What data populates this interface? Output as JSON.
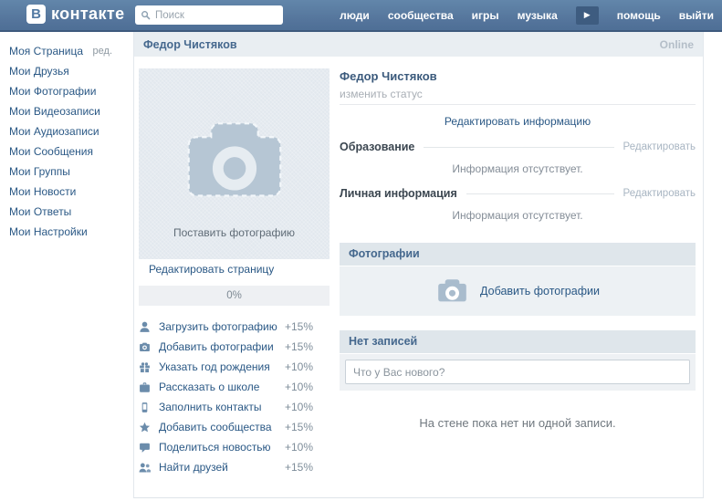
{
  "topbar": {
    "logo_letter": "В",
    "logo_word": "контакте",
    "search": {
      "placeholder": "Поиск"
    },
    "nav_items": [
      "люди",
      "сообщества",
      "игры",
      "музыка"
    ],
    "nav_items_after": [
      "помощь",
      "выйти"
    ]
  },
  "sidebar": {
    "items": [
      {
        "label": "Моя Страница",
        "edit": "ред."
      },
      {
        "label": "Мои Друзья"
      },
      {
        "label": "Мои Фотографии"
      },
      {
        "label": "Мои Видеозаписи"
      },
      {
        "label": "Мои Аудиозаписи"
      },
      {
        "label": "Мои Сообщения"
      },
      {
        "label": "Мои Группы"
      },
      {
        "label": "Мои Новости"
      },
      {
        "label": "Мои Ответы"
      },
      {
        "label": "Мои Настройки"
      }
    ]
  },
  "header": {
    "title": "Федор Чистяков",
    "status": "Online"
  },
  "profile_left": {
    "photo_placeholder_label": "Поставить фотографию",
    "edit_page_link": "Редактировать страницу",
    "progress_percent": "0%",
    "checklist": [
      {
        "icon": "person-icon",
        "label": "Загрузить фотографию",
        "bonus": "+15%"
      },
      {
        "icon": "camera-icon",
        "label": "Добавить фотографии",
        "bonus": "+15%"
      },
      {
        "icon": "gift-icon",
        "label": "Указать год рождения",
        "bonus": "+10%"
      },
      {
        "icon": "briefcase-icon",
        "label": "Рассказать о школе",
        "bonus": "+10%"
      },
      {
        "icon": "phone-icon",
        "label": "Заполнить контакты",
        "bonus": "+10%"
      },
      {
        "icon": "star-icon",
        "label": "Добавить сообщества",
        "bonus": "+15%"
      },
      {
        "icon": "comment-icon",
        "label": "Поделиться новостью",
        "bonus": "+10%"
      },
      {
        "icon": "friends-icon",
        "label": "Найти друзей",
        "bonus": "+15%"
      }
    ]
  },
  "profile_main": {
    "name": "Федор Чистяков",
    "change_status": "изменить статус",
    "edit_info_link": "Редактировать информацию",
    "sections": [
      {
        "title": "Образование",
        "edit": "Редактировать",
        "empty": "Информация отсутствует."
      },
      {
        "title": "Личная информация",
        "edit": "Редактировать",
        "empty": "Информация отсутствует."
      }
    ],
    "photos_block": {
      "title": "Фотографии",
      "add_link": "Добавить фотографии"
    },
    "wall": {
      "title": "Нет записей",
      "post_placeholder": "Что у Вас нового?",
      "empty_text": "На стене пока нет ни одной записи."
    }
  },
  "colors": {
    "link_blue": "#2a5885",
    "navbar_top": "#6286aa",
    "navbar_bottom": "#4e6f96",
    "page_header_bg": "#e9eef2",
    "block_header_bg": "#dfe6eb",
    "block_body_bg": "#edf1f4"
  }
}
